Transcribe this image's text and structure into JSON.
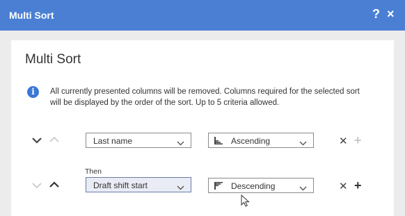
{
  "dialog": {
    "title": "Multi Sort",
    "help_glyph": "?",
    "close_glyph": "×"
  },
  "main": {
    "heading": "Multi Sort",
    "info": "All currently presented columns will be removed. Columns required for the selected sort will be displayed by the order of the sort. Up to 5 criteria allowed."
  },
  "criteria": [
    {
      "column": "Last name",
      "order": "Ascending",
      "then_label": "",
      "down_enabled": true,
      "up_enabled": false,
      "add_enabled": false
    },
    {
      "column": "Draft shift start",
      "order": "Descending",
      "then_label": "Then",
      "down_enabled": false,
      "up_enabled": true,
      "add_enabled": true
    }
  ],
  "icons": {
    "help": "help-icon",
    "close": "close-icon",
    "info": "info-icon",
    "move_down": "chevron-down-icon",
    "move_up": "chevron-up-icon",
    "ascending": "sort-ascending-icon",
    "descending": "sort-descending-icon",
    "remove": "remove-icon",
    "add": "plus-icon",
    "cursor": "mouse-cursor-icon"
  },
  "colors": {
    "titlebar": "#4a7fd4",
    "info": "#3a78d6",
    "disabled": "#c8c8c8"
  }
}
